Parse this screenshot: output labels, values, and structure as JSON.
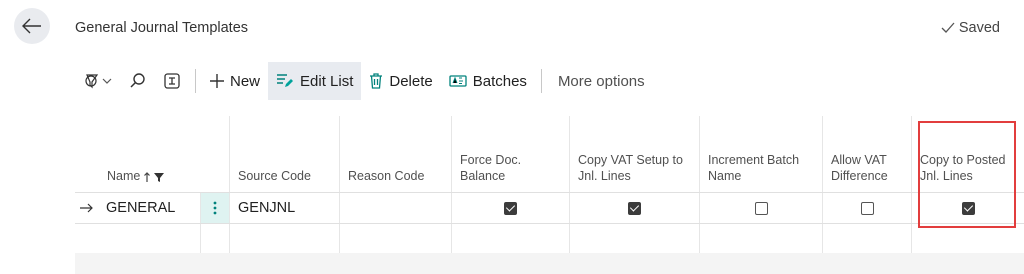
{
  "header": {
    "title": "General Journal Templates",
    "saved_label": "Saved"
  },
  "toolbar": {
    "new_label": "New",
    "edit_list_label": "Edit List",
    "delete_label": "Delete",
    "batches_label": "Batches",
    "more_options_label": "More options"
  },
  "columns": [
    "Name",
    "Source Code",
    "Reason Code",
    "Force Doc. Balance",
    "Copy VAT Setup to Jnl. Lines",
    "Increment Batch Name",
    "Allow VAT Difference",
    "Copy to Posted Jnl. Lines"
  ],
  "rows": [
    {
      "name": "GENERAL",
      "source_code": "GENJNL",
      "reason_code": "",
      "force_doc_balance": true,
      "copy_vat_setup": true,
      "increment_batch_name": false,
      "allow_vat_difference": false,
      "copy_to_posted": true
    }
  ],
  "colors": {
    "accent": "#00a39c",
    "highlight": "#e23d3d"
  }
}
